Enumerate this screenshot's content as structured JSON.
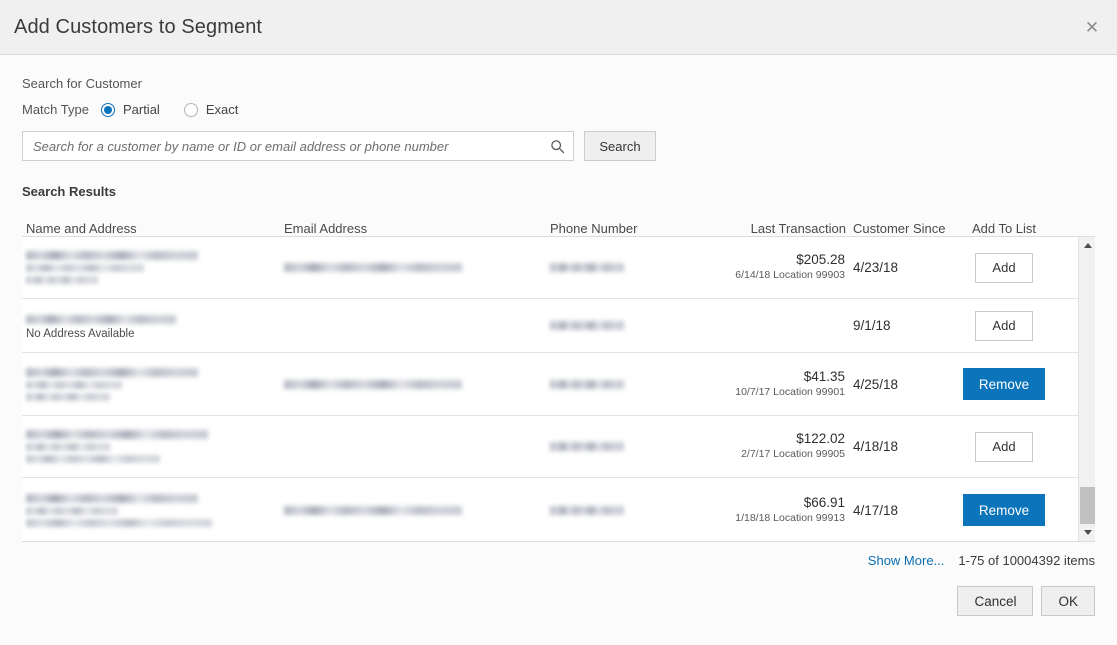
{
  "dialog": {
    "title": "Add Customers to Segment",
    "close_icon": "close-icon"
  },
  "search": {
    "section_label": "Search for Customer",
    "match_type_label": "Match Type",
    "options": [
      {
        "label": "Partial",
        "selected": true
      },
      {
        "label": "Exact",
        "selected": false
      }
    ],
    "placeholder": "Search for a customer by name or ID or email address or phone number",
    "value": "",
    "search_icon": "search-icon",
    "search_button": "Search"
  },
  "results": {
    "heading": "Search Results",
    "columns": [
      "Name and Address",
      "Email Address",
      "Phone Number",
      "Last Transaction",
      "Customer Since",
      "Add To List"
    ],
    "rows": [
      {
        "name_redacted": true,
        "address_lines": 3,
        "no_address_text": "",
        "email_redacted": true,
        "phone_redacted": true,
        "last_transaction_amount": "$205.28",
        "last_transaction_detail": "6/14/18 Location 99903",
        "customer_since": "4/23/18",
        "action_label": "Add",
        "action_state": "add"
      },
      {
        "name_redacted": true,
        "address_lines": 0,
        "no_address_text": "No Address Available",
        "email_redacted": false,
        "phone_redacted": true,
        "last_transaction_amount": "",
        "last_transaction_detail": "",
        "customer_since": "9/1/18",
        "action_label": "Add",
        "action_state": "add"
      },
      {
        "name_redacted": true,
        "address_lines": 3,
        "no_address_text": "",
        "email_redacted": true,
        "phone_redacted": true,
        "last_transaction_amount": "$41.35",
        "last_transaction_detail": "10/7/17 Location 99901",
        "customer_since": "4/25/18",
        "action_label": "Remove",
        "action_state": "remove"
      },
      {
        "name_redacted": true,
        "address_lines": 3,
        "no_address_text": "",
        "email_redacted": false,
        "phone_redacted": true,
        "last_transaction_amount": "$122.02",
        "last_transaction_detail": "2/7/17 Location 99905",
        "customer_since": "4/18/18",
        "action_label": "Add",
        "action_state": "add"
      },
      {
        "name_redacted": true,
        "address_lines": 3,
        "no_address_text": "",
        "email_redacted": true,
        "phone_redacted": true,
        "last_transaction_amount": "$66.91",
        "last_transaction_detail": "1/18/18 Location 99913",
        "customer_since": "4/17/18",
        "action_label": "Remove",
        "action_state": "remove"
      }
    ],
    "scrollbar": {
      "up_icon": "chevron-up-icon",
      "down_icon": "chevron-down-icon"
    }
  },
  "footer": {
    "show_more": "Show More...",
    "item_count": "1-75 of 10004392 items",
    "cancel": "Cancel",
    "ok": "OK"
  },
  "colors": {
    "accent": "#0c74ba",
    "link": "#0c6fb4",
    "titlebar_bg": "#f0f0f0",
    "body_bg": "#fbfbfb"
  }
}
